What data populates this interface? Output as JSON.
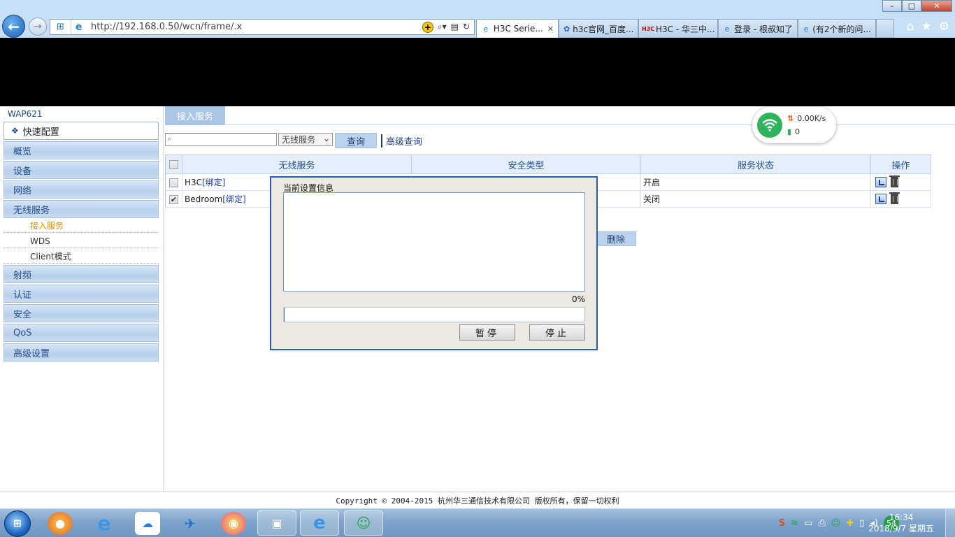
{
  "browser": {
    "url": "http://192.168.0.50/wcn/frame/.x",
    "tabs": [
      {
        "label": "H3C Serie...",
        "active": true,
        "icon": "ie-icon"
      },
      {
        "label": "h3c官网_百度...",
        "active": false,
        "icon": "baidu-icon"
      },
      {
        "label": "H3C - 华三中...",
        "active": false,
        "icon": "h3c-icon"
      },
      {
        "label": "登录 - 根叔知了",
        "active": false,
        "icon": "ie-icon"
      },
      {
        "label": "(有2个新的问...",
        "active": false,
        "icon": "ie-icon"
      }
    ],
    "window_controls": {
      "minimize": "–",
      "maximize": "□",
      "close": "✕"
    }
  },
  "sidebar": {
    "device_name": "WAP621",
    "quick_setup": "快速配置",
    "nav": [
      {
        "label": "概览"
      },
      {
        "label": "设备"
      },
      {
        "label": "网络"
      },
      {
        "label": "无线服务"
      }
    ],
    "sub_items": [
      {
        "label": "接入服务",
        "current": true
      },
      {
        "label": "WDS",
        "current": false
      },
      {
        "label": "Client模式",
        "current": false
      }
    ],
    "nav_after": [
      {
        "label": "射频"
      },
      {
        "label": "认证"
      },
      {
        "label": "安全"
      },
      {
        "label": "QoS"
      },
      {
        "label": "高级设置"
      }
    ]
  },
  "main": {
    "tab_label": "接入服务",
    "search_placeholder": "",
    "select_value": "无线服务",
    "query_button": "查询",
    "advanced_query": "高级查询",
    "table": {
      "headers": [
        "无线服务",
        "安全类型",
        "服务状态",
        "操作"
      ],
      "rows": [
        {
          "name": "H3C",
          "bind": "[绑定]",
          "security": "",
          "status": "开启",
          "checked": false
        },
        {
          "name": "Bedroom",
          "bind": "[绑定]",
          "security": "",
          "status": "关闭",
          "checked": true
        }
      ]
    },
    "delete_button": "删除"
  },
  "dialog": {
    "title": "当前设置信息",
    "log": "",
    "percent": "0%",
    "progress": 0,
    "pause_button": "暂停",
    "stop_button": "停止"
  },
  "net_widget": {
    "speed": "0.00K/s",
    "battery": "0"
  },
  "footer": {
    "copyright": "Copyright © 2004-2015 杭州华三通信技术有限公司 版权所有，保留一切权利"
  },
  "taskbar": {
    "tray_badge": "54",
    "time": "16:34",
    "date": "2018/9/7 星期五"
  },
  "colors": {
    "accent": "#1d4f91",
    "nav_bg": "#c9dcf2",
    "current_sub": "#e08c00",
    "dialog_border": "#2a5bbf"
  }
}
